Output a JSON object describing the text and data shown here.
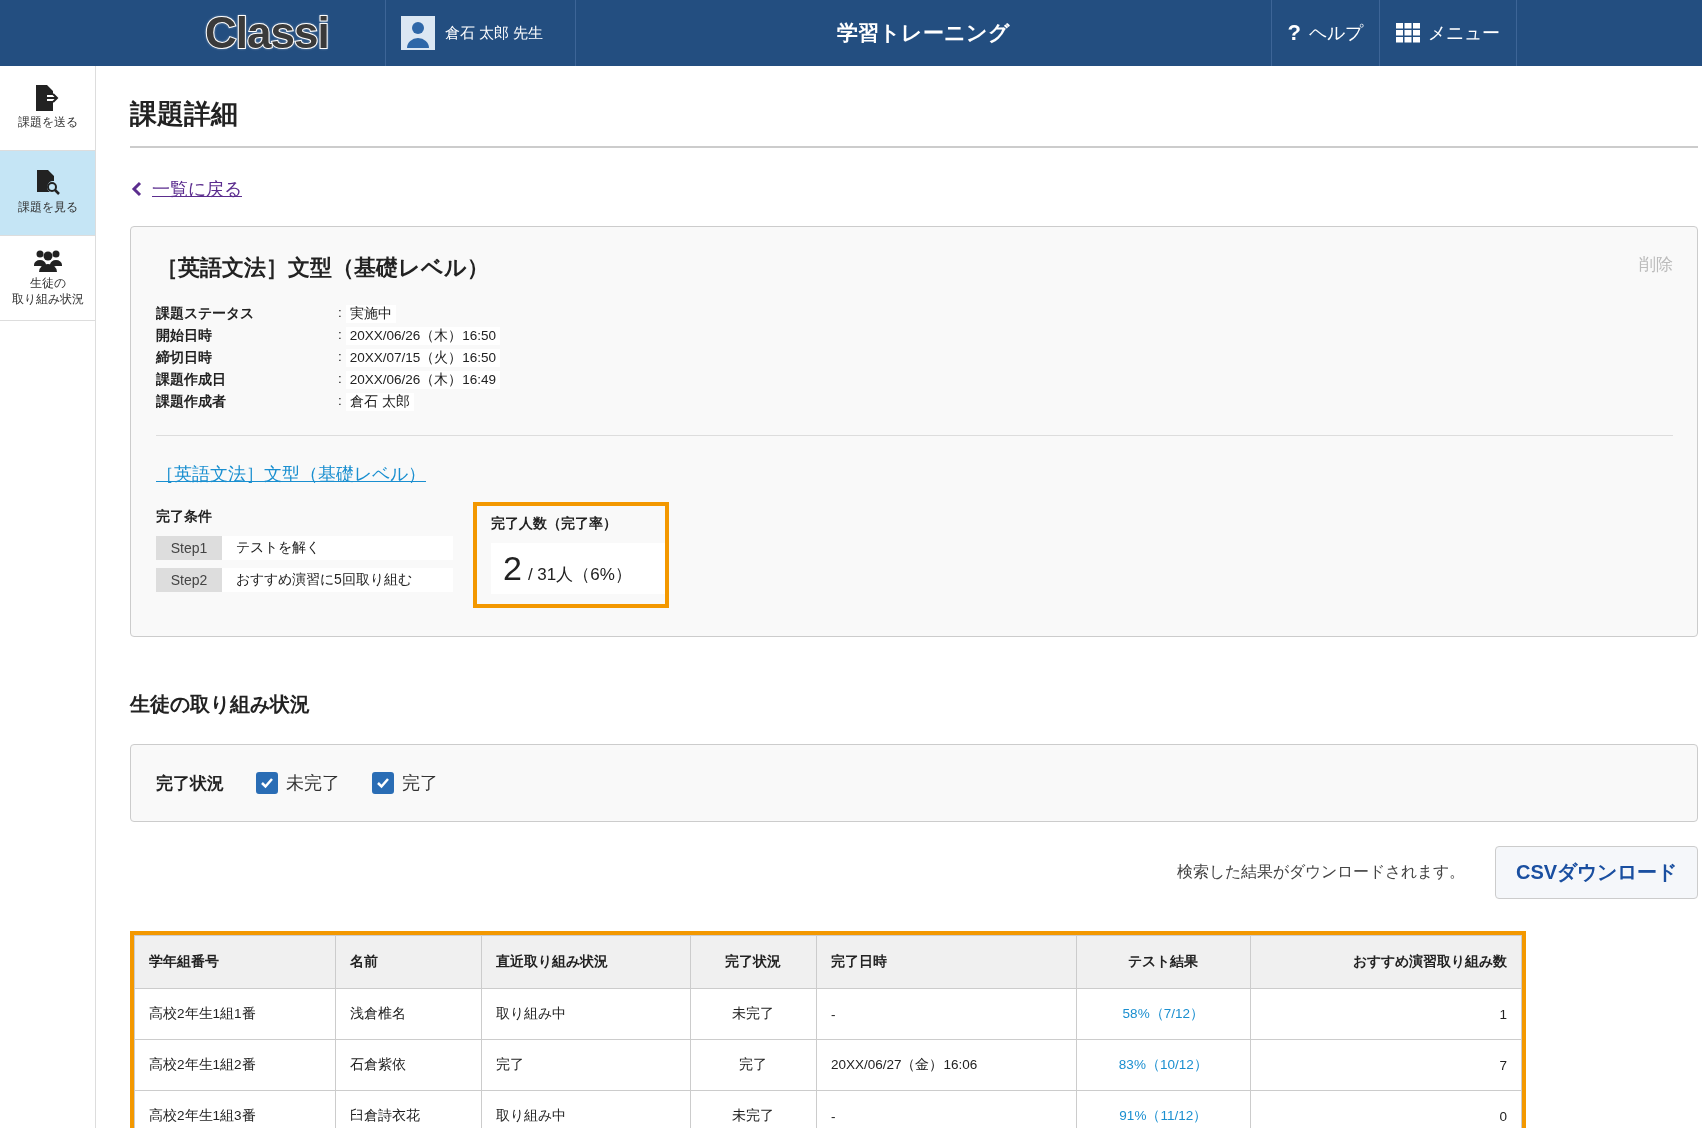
{
  "header": {
    "logo": "Classi",
    "user_name": "倉石 太郎 先生",
    "title": "学習トレーニング",
    "help_icon": "?",
    "help": "ヘルプ",
    "menu": "メニュー"
  },
  "sidebar": {
    "items": [
      {
        "label": [
          "課題を送る"
        ],
        "kind": "send",
        "selected": false
      },
      {
        "label": [
          "課題を見る"
        ],
        "kind": "view",
        "selected": true
      },
      {
        "label": [
          "生徒の",
          "取り組み状況"
        ],
        "kind": "people",
        "selected": false
      }
    ]
  },
  "page_title": "課題詳細",
  "back_link": "一覧に戻る",
  "assignment": {
    "title": "［英語文法］文型（基礎レベル）",
    "delete": "削除",
    "fields": [
      {
        "label": "課題ステータス",
        "separator": ":",
        "value": "実施中"
      },
      {
        "label": "開始日時",
        "separator": ":",
        "value": "20XX/06/26（木）16:50"
      },
      {
        "label": "締切日時",
        "separator": ":",
        "value": "20XX/07/15（火）16:50"
      },
      {
        "label": "課題作成日",
        "separator": ":",
        "value": "20XX/06/26（木）16:49"
      },
      {
        "label": "課題作成者",
        "separator": ":",
        "value": "倉石 太郎"
      }
    ],
    "link": "［英語文法］文型（基礎レベル）",
    "conditions": {
      "label": "完了条件",
      "steps": [
        {
          "step": "Step1",
          "text": "テストを解く"
        },
        {
          "step": "Step2",
          "text": "おすすめ演習に5回取り組む"
        }
      ]
    },
    "completion": {
      "label": "完了人数（完了率）",
      "count": "2",
      "rest": "/ 31人（6%）",
      "highlighted": true
    }
  },
  "section_title": "生徒の取り組み状況",
  "filter": {
    "label": "完了状況",
    "options": [
      {
        "label": "未完了",
        "checked": true
      },
      {
        "label": "完了",
        "checked": true
      }
    ]
  },
  "download": {
    "note": "検索した結果がダウンロードされます。",
    "button": "CSVダウンロード"
  },
  "table": {
    "highlighted": true,
    "columns": [
      "学年組番号",
      "名前",
      "直近取り組み状況",
      "完了状況",
      "完了日時",
      "テスト結果",
      "おすすめ演習取り組み数"
    ],
    "rows": [
      [
        "高校2年生1組1番",
        "浅倉椎名",
        "取り組み中",
        "未完了",
        "-",
        "58%（7/12）",
        "1"
      ],
      [
        "高校2年生1組2番",
        "石倉紫依",
        "完了",
        "完了",
        "20XX/06/27（金）16:06",
        "83%（10/12）",
        "7"
      ],
      [
        "高校2年生1組3番",
        "臼倉詩衣花",
        "取り組み中",
        "未完了",
        "-",
        "91%（11/12）",
        "0"
      ]
    ]
  }
}
